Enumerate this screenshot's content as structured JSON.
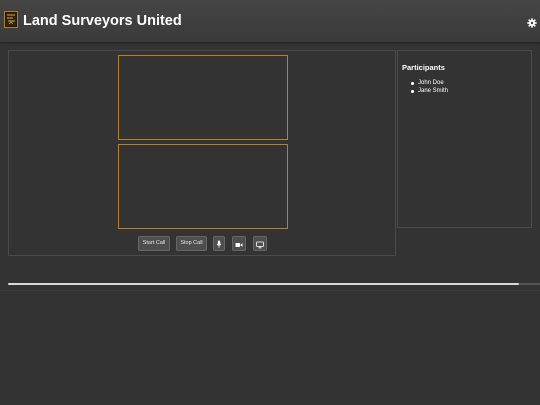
{
  "header": {
    "app_title": "Land Surveyors United",
    "logo_icon": "surveyor-logo-icon",
    "settings_icon": "gear-icon"
  },
  "video": {
    "tiles": [
      "video-tile-1",
      "video-tile-2"
    ]
  },
  "controls": {
    "start_label": "Start Call",
    "stop_label": "Stop Call",
    "mic_icon": "microphone-icon",
    "camera_icon": "video-camera-icon",
    "screen_icon": "screen-share-icon"
  },
  "participants": {
    "title": "Participants",
    "items": [
      "John Doe",
      "Jane Smith"
    ]
  },
  "progress": {
    "fraction": 0.96
  },
  "colors": {
    "background": "#333333",
    "header": "#404040",
    "tile_border": "#b5802a",
    "panel_border": "#4a4a4a",
    "button": "#4e4e4e",
    "text": "#ffffff"
  }
}
